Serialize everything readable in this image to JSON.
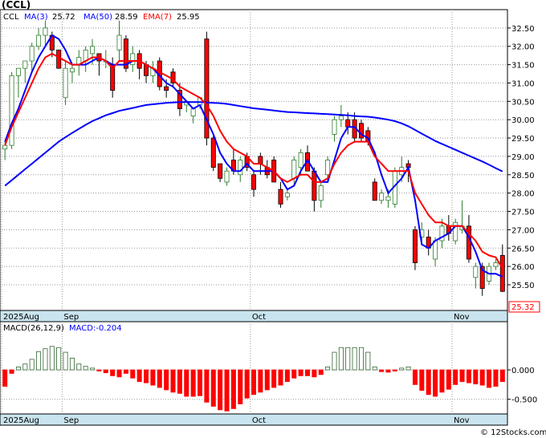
{
  "ticker_title": "(CCL)",
  "legend": {
    "symbol": "CCL",
    "ma3": "MA(3)",
    "ma3_value": "25.72",
    "ma50": "MA(50)",
    "ma50_value": "28.59",
    "ema7": "EMA(7)",
    "ema7_value": "25.95"
  },
  "macd_legend": {
    "params": "MACD(26,12,9)",
    "value": "MACD:-0.204"
  },
  "last_price_label": "25.32",
  "watermark": "© 12Stocks.com",
  "colors": {
    "up": "#2e7d2e",
    "down": "#ff0000",
    "ma3": "#0000ff",
    "ma50": "#0000ff",
    "ema7": "#ff0000",
    "macd_pos": "#336633",
    "macd_neg": "#ff0000",
    "axis_band": "#c9e4ef"
  },
  "chart_data": [
    {
      "type": "candlestick",
      "title": "(CCL)",
      "x_tick_labels": [
        "2025Aug",
        "Sep",
        "Oct",
        "Nov"
      ],
      "x_tick_index": [
        0,
        9,
        37,
        67
      ],
      "ylim": [
        24.8,
        33.0
      ],
      "y_ticks": [
        25.5,
        26.0,
        26.5,
        27.0,
        27.5,
        28.0,
        28.5,
        29.0,
        29.5,
        30.0,
        30.5,
        31.0,
        31.5,
        32.0,
        32.5
      ],
      "y_tick_labels": [
        "25.50",
        "26.00",
        "26.50",
        "27.00",
        "27.50",
        "28.00",
        "28.50",
        "29.00",
        "29.50",
        "30.00",
        "30.50",
        "31.00",
        "31.50",
        "32.00",
        "32.50"
      ],
      "ohlc": [
        [
          29.2,
          29.4,
          28.9,
          29.3
        ],
        [
          29.3,
          31.3,
          29.2,
          31.2
        ],
        [
          31.2,
          31.4,
          30.6,
          31.4
        ],
        [
          31.4,
          31.6,
          31.0,
          31.6
        ],
        [
          31.6,
          32.1,
          31.3,
          32.0
        ],
        [
          32.0,
          32.5,
          31.9,
          32.3
        ],
        [
          32.3,
          32.7,
          32.0,
          32.5
        ],
        [
          32.3,
          32.4,
          31.7,
          31.9
        ],
        [
          31.9,
          31.9,
          31.4,
          31.4
        ],
        [
          30.6,
          31.6,
          30.4,
          31.4
        ],
        [
          31.3,
          31.5,
          31.0,
          31.4
        ],
        [
          31.5,
          31.9,
          31.2,
          31.7
        ],
        [
          31.6,
          32.0,
          31.3,
          31.9
        ],
        [
          31.8,
          32.2,
          31.5,
          32.0
        ],
        [
          31.8,
          31.8,
          31.2,
          31.6
        ],
        [
          31.6,
          31.9,
          31.4,
          31.6
        ],
        [
          31.5,
          31.7,
          30.6,
          30.8
        ],
        [
          31.9,
          32.7,
          31.6,
          32.3
        ],
        [
          32.2,
          32.3,
          31.3,
          31.4
        ],
        [
          31.5,
          32.0,
          31.3,
          31.8
        ],
        [
          31.8,
          31.9,
          31.1,
          31.4
        ],
        [
          31.5,
          31.6,
          31.0,
          31.2
        ],
        [
          31.2,
          31.6,
          31.0,
          31.4
        ],
        [
          31.6,
          31.7,
          30.8,
          30.9
        ],
        [
          30.9,
          31.1,
          30.6,
          30.8
        ],
        [
          31.3,
          31.4,
          30.9,
          31.0
        ],
        [
          30.8,
          31.0,
          30.1,
          30.3
        ],
        [
          30.4,
          30.5,
          30.2,
          30.5
        ],
        [
          30.1,
          30.3,
          29.9,
          30.3
        ],
        [
          30.4,
          30.6,
          30.3,
          30.6
        ],
        [
          32.2,
          32.4,
          29.3,
          29.5
        ],
        [
          29.5,
          29.6,
          28.6,
          28.7
        ],
        [
          28.8,
          28.8,
          28.3,
          28.4
        ],
        [
          28.3,
          28.7,
          28.2,
          28.6
        ],
        [
          28.9,
          29.2,
          28.5,
          28.6
        ],
        [
          28.5,
          29.0,
          28.3,
          28.9
        ],
        [
          29.0,
          29.1,
          28.6,
          28.7
        ],
        [
          28.5,
          28.6,
          27.9,
          28.1
        ],
        [
          29.0,
          29.1,
          28.5,
          28.8
        ],
        [
          28.7,
          28.9,
          28.4,
          28.5
        ],
        [
          28.9,
          29.0,
          28.3,
          28.3
        ],
        [
          28.1,
          28.3,
          27.6,
          27.7
        ],
        [
          27.9,
          28.1,
          27.8,
          28.0
        ],
        [
          28.4,
          29.0,
          28.2,
          28.9
        ],
        [
          28.7,
          29.2,
          28.5,
          29.1
        ],
        [
          29.1,
          29.3,
          28.6,
          28.6
        ],
        [
          28.6,
          28.7,
          27.5,
          27.8
        ],
        [
          27.8,
          28.3,
          27.6,
          28.2
        ],
        [
          28.5,
          29.0,
          28.3,
          28.9
        ],
        [
          29.6,
          30.1,
          29.4,
          30.0
        ],
        [
          30.0,
          30.4,
          29.8,
          30.1
        ],
        [
          30.0,
          30.2,
          29.6,
          29.8
        ],
        [
          30.0,
          30.2,
          29.4,
          29.5
        ],
        [
          29.9,
          30.0,
          29.4,
          29.5
        ],
        [
          29.7,
          29.8,
          29.3,
          29.4
        ],
        [
          28.3,
          28.4,
          27.8,
          27.8
        ],
        [
          27.8,
          28.1,
          27.7,
          28.0
        ],
        [
          27.8,
          28.1,
          27.6,
          27.9
        ],
        [
          27.7,
          28.7,
          27.6,
          28.6
        ],
        [
          28.5,
          29.0,
          28.3,
          28.7
        ],
        [
          28.8,
          28.9,
          28.3,
          28.7
        ],
        [
          27.0,
          27.1,
          25.9,
          26.1
        ],
        [
          26.8,
          27.2,
          26.6,
          27.0
        ],
        [
          26.8,
          27.0,
          26.3,
          26.5
        ],
        [
          26.2,
          26.8,
          26.0,
          26.7
        ],
        [
          26.7,
          27.3,
          26.5,
          27.1
        ],
        [
          27.1,
          27.4,
          26.7,
          26.9
        ],
        [
          26.7,
          27.3,
          26.6,
          27.2
        ],
        [
          27.0,
          27.8,
          26.9,
          27.1
        ],
        [
          27.1,
          27.4,
          26.1,
          26.2
        ],
        [
          25.7,
          26.1,
          25.4,
          26.0
        ],
        [
          26.0,
          26.1,
          25.2,
          25.4
        ],
        [
          25.6,
          26.1,
          25.5,
          26.0
        ],
        [
          26.0,
          26.2,
          25.9,
          26.1
        ],
        [
          26.3,
          26.6,
          25.3,
          25.32
        ]
      ],
      "series": [
        {
          "name": "MA(3)",
          "values": [
            29.4,
            29.9,
            30.3,
            30.8,
            31.3,
            31.7,
            32.0,
            32.3,
            32.2,
            31.9,
            31.5,
            31.5,
            31.5,
            31.6,
            31.7,
            31.6,
            31.5,
            31.5,
            31.5,
            31.6,
            31.6,
            31.5,
            31.4,
            31.2,
            31.0,
            30.9,
            30.7,
            30.5,
            30.3,
            30.4,
            30.0,
            29.6,
            29.1,
            28.8,
            28.6,
            28.6,
            28.8,
            28.6,
            28.6,
            28.6,
            28.6,
            28.4,
            28.1,
            28.2,
            28.6,
            28.9,
            28.6,
            28.3,
            28.3,
            28.9,
            29.5,
            29.8,
            29.8,
            29.6,
            29.5,
            29.1,
            28.5,
            28.0,
            28.2,
            28.4,
            28.7,
            27.8,
            26.6,
            26.5,
            26.7,
            26.8,
            26.9,
            27.1,
            27.1,
            26.8,
            26.4,
            25.9,
            25.8,
            25.8,
            25.72
          ]
        },
        {
          "name": "MA(50)",
          "values": [
            28.2,
            28.35,
            28.5,
            28.65,
            28.8,
            28.95,
            29.1,
            29.25,
            29.4,
            29.52,
            29.64,
            29.75,
            29.86,
            29.96,
            30.04,
            30.12,
            30.18,
            30.24,
            30.28,
            30.32,
            30.36,
            30.4,
            30.42,
            30.44,
            30.46,
            30.47,
            30.48,
            30.48,
            30.48,
            30.48,
            30.47,
            30.46,
            30.45,
            30.43,
            30.4,
            30.37,
            30.34,
            30.31,
            30.29,
            30.27,
            30.25,
            30.23,
            30.21,
            30.2,
            30.19,
            30.18,
            30.17,
            30.16,
            30.15,
            30.14,
            30.13,
            30.12,
            30.1,
            30.09,
            30.08,
            30.06,
            30.03,
            30.0,
            29.96,
            29.9,
            29.82,
            29.72,
            29.62,
            29.52,
            29.42,
            29.34,
            29.26,
            29.18,
            29.1,
            29.02,
            28.94,
            28.86,
            28.77,
            28.68,
            28.59
          ]
        },
        {
          "name": "EMA(7)",
          "values": [
            29.3,
            29.8,
            30.2,
            30.6,
            31.0,
            31.4,
            31.7,
            31.8,
            31.7,
            31.6,
            31.5,
            31.5,
            31.6,
            31.7,
            31.7,
            31.6,
            31.4,
            31.6,
            31.6,
            31.6,
            31.6,
            31.5,
            31.4,
            31.3,
            31.2,
            31.1,
            30.9,
            30.8,
            30.7,
            30.6,
            30.4,
            30.1,
            29.7,
            29.4,
            29.2,
            29.1,
            29.0,
            28.8,
            28.8,
            28.7,
            28.6,
            28.4,
            28.3,
            28.4,
            28.5,
            28.5,
            28.3,
            28.3,
            28.4,
            28.8,
            29.1,
            29.3,
            29.4,
            29.4,
            29.4,
            29.0,
            28.8,
            28.6,
            28.6,
            28.6,
            28.6,
            28.0,
            27.7,
            27.4,
            27.2,
            27.2,
            27.1,
            27.1,
            27.1,
            26.9,
            26.7,
            26.4,
            26.3,
            26.25,
            25.95
          ]
        }
      ]
    },
    {
      "type": "bar",
      "title": "MACD(26,12,9)",
      "ylim": [
        -0.75,
        0.82
      ],
      "y_ticks": [
        0.0,
        -0.5
      ],
      "y_tick_labels": [
        "0.000",
        "-0.500"
      ],
      "x_tick_labels": [
        "2025Aug",
        "Sep",
        "Oct",
        "Nov"
      ],
      "values": [
        -0.28,
        -0.06,
        0.05,
        0.1,
        0.18,
        0.31,
        0.36,
        0.4,
        0.38,
        0.3,
        0.2,
        0.1,
        0.06,
        0.03,
        -0.02,
        -0.05,
        -0.1,
        -0.12,
        -0.06,
        -0.14,
        -0.2,
        -0.22,
        -0.26,
        -0.3,
        -0.34,
        -0.38,
        -0.4,
        -0.45,
        -0.45,
        -0.44,
        -0.55,
        -0.62,
        -0.68,
        -0.7,
        -0.66,
        -0.58,
        -0.48,
        -0.42,
        -0.38,
        -0.34,
        -0.3,
        -0.26,
        -0.2,
        -0.14,
        -0.1,
        -0.1,
        -0.12,
        -0.08,
        0.05,
        0.3,
        0.38,
        0.38,
        0.38,
        0.38,
        0.3,
        0.05,
        -0.03,
        -0.04,
        -0.02,
        0.03,
        0.05,
        -0.25,
        -0.35,
        -0.42,
        -0.45,
        -0.38,
        -0.33,
        -0.25,
        -0.2,
        -0.22,
        -0.24,
        -0.26,
        -0.3,
        -0.28,
        -0.2
      ]
    }
  ]
}
